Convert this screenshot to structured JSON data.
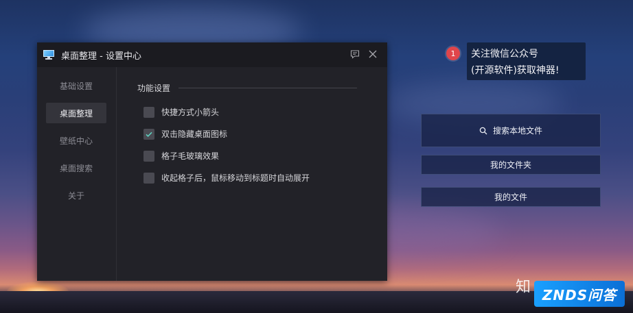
{
  "window": {
    "title": "桌面整理 - 设置中心",
    "feedback_icon": "message-square-icon",
    "close_icon": "close-icon"
  },
  "sidebar": {
    "items": [
      {
        "label": "基础设置",
        "active": false
      },
      {
        "label": "桌面整理",
        "active": true
      },
      {
        "label": "壁纸中心",
        "active": false
      },
      {
        "label": "桌面搜索",
        "active": false
      },
      {
        "label": "关于",
        "active": false
      }
    ]
  },
  "content": {
    "section_title": "功能设置",
    "options": [
      {
        "label": "快捷方式小箭头",
        "checked": false
      },
      {
        "label": "双击隐藏桌面图标",
        "checked": true
      },
      {
        "label": "格子毛玻璃效果",
        "checked": false
      },
      {
        "label": "收起格子后，鼠标移动到标题时自动展开",
        "checked": false
      }
    ]
  },
  "tip": {
    "badge": "1",
    "line1": "关注微信公众号",
    "line2": "(开源软件)获取神器!"
  },
  "right_panel": {
    "search_label": "搜索本地文件",
    "folder_label": "我的文件夹",
    "files_label": "我的文件"
  },
  "watermark": {
    "zhihu": "知",
    "znds": "ZNDS问答"
  },
  "colors": {
    "window_bg": "#222228",
    "titlebar_bg": "#1b1b20",
    "active_nav_bg": "#34343b",
    "checkbox_bg": "#4a4a52",
    "check_mark": "#5fd3c0",
    "badge_red": "#e0454b",
    "znds_blue": "#1aa0ff"
  }
}
